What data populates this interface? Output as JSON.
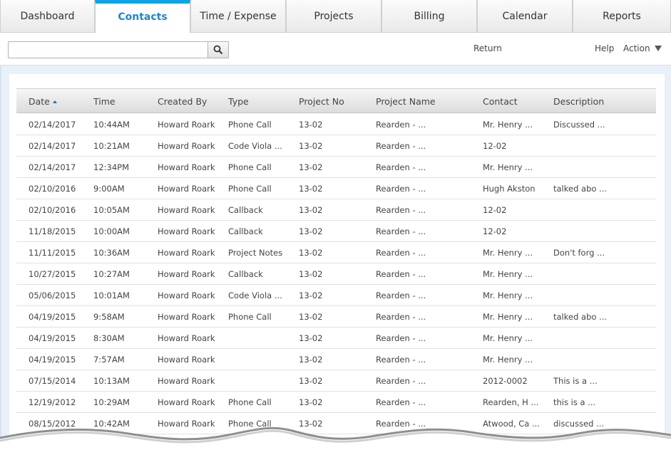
{
  "tabs": [
    {
      "label": "Dashboard"
    },
    {
      "label": "Contacts"
    },
    {
      "label": "Time / Expense"
    },
    {
      "label": "Projects"
    },
    {
      "label": "Billing"
    },
    {
      "label": "Calendar"
    },
    {
      "label": "Reports"
    }
  ],
  "active_tab": "Contacts",
  "toolbar": {
    "search_value": "",
    "return_label": "Return",
    "help_label": "Help",
    "action_label": "Action"
  },
  "table": {
    "columns": [
      "Date",
      "Time",
      "Created By",
      "Type",
      "Project No",
      "Project Name",
      "Contact",
      "Description"
    ],
    "sorted_column": "Date",
    "rows": [
      [
        "02/14/2017",
        "10:44AM",
        "Howard Roark",
        "Phone Call",
        "13-02",
        "Rearden - ...",
        "Mr. Henry ...",
        "Discussed ..."
      ],
      [
        "02/14/2017",
        "10:21AM",
        "Howard Roark",
        "Code Viola ...",
        "13-02",
        "Rearden - ...",
        "12-02",
        ""
      ],
      [
        "02/14/2017",
        "12:34PM",
        "Howard Roark",
        "Phone Call",
        "13-02",
        "Rearden - ...",
        "Mr. Henry ...",
        ""
      ],
      [
        "02/10/2016",
        "9:00AM",
        "Howard Roark",
        "Phone Call",
        "13-02",
        "Rearden - ...",
        "Hugh Akston",
        "talked abo ..."
      ],
      [
        "02/10/2016",
        "10:05AM",
        "Howard Roark",
        "Callback",
        "13-02",
        "Rearden - ...",
        "12-02",
        ""
      ],
      [
        "11/18/2015",
        "10:00AM",
        "Howard Roark",
        "Callback",
        "13-02",
        "Rearden - ...",
        "12-02",
        ""
      ],
      [
        "11/11/2015",
        "10:36AM",
        "Howard Roark",
        "Project Notes",
        "13-02",
        "Rearden - ...",
        "Mr. Henry ...",
        "Don't forg ..."
      ],
      [
        "10/27/2015",
        "10:27AM",
        "Howard Roark",
        "Callback",
        "13-02",
        "Rearden - ...",
        "Mr. Henry ...",
        ""
      ],
      [
        "05/06/2015",
        "10:01AM",
        "Howard Roark",
        "Code Viola ...",
        "13-02",
        "Rearden - ...",
        "Mr. Henry ...",
        ""
      ],
      [
        "04/19/2015",
        "9:58AM",
        "Howard Roark",
        "Phone Call",
        "13-02",
        "Rearden - ...",
        "Mr. Henry ...",
        "talked abo ..."
      ],
      [
        "04/19/2015",
        "8:30AM",
        "Howard Roark",
        "",
        "13-02",
        "Rearden - ...",
        "Mr. Henry ...",
        ""
      ],
      [
        "04/19/2015",
        "7:57AM",
        "Howard Roark",
        "",
        "13-02",
        "Rearden - ...",
        "Mr. Henry ...",
        ""
      ],
      [
        "07/15/2014",
        "10:13AM",
        "Howard Roark",
        "",
        "13-02",
        "Rearden - ...",
        "2012-0002",
        "This is a ..."
      ],
      [
        "12/19/2012",
        "10:29AM",
        "Howard Roark",
        "Phone Call",
        "13-02",
        "Rearden - ...",
        "Rearden, H ...",
        "this is a ..."
      ],
      [
        "08/15/2012",
        "10:42AM",
        "Howard Roark",
        "Phone Call",
        "13-02",
        "Rearden - ...",
        "Atwood, Ca ...",
        "discussed ..."
      ]
    ]
  },
  "colors": {
    "active_tab_accent": "#0aa3e8",
    "active_tab_text": "#1f86c7",
    "content_background": "#e8f1fa"
  },
  "icons": {
    "search": "search-icon",
    "sort": "sort-ascending-icon",
    "action": "caret-down-icon"
  }
}
